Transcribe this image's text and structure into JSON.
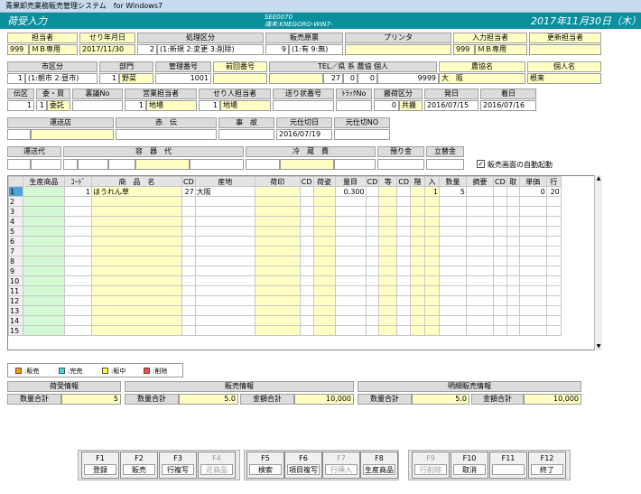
{
  "app_title": "青果卸売業務販売管理システム　for Windows7",
  "screen": {
    "title": "荷受入力",
    "program_id": "SEE0070",
    "terminal": "端末:KNEGORO-WIN7-",
    "date": "2017年11月30日（木）"
  },
  "row1": {
    "h_tanto": "担当者",
    "h_seri": "せり年月日",
    "h_shori": "処理区分",
    "h_hanbai": "販売原票",
    "h_printer": "プリンタ",
    "h_nyuryoku": "入力担当者",
    "h_koshin": "更新担当者",
    "tanto_code": "999",
    "tanto_name": "ＭＢ専用",
    "seri": "2017/11/30",
    "shori_code": "2",
    "shori_text": "(1:新規 2:変更 3:削除)",
    "hanbai_code": "9",
    "hanbai_text": "(1:有 9:無)",
    "nyuryoku_code": "999",
    "nyuryoku_name": "ＭＢ専用"
  },
  "row2": {
    "h_ichi": "市区分",
    "h_bumon": "部門",
    "h_kanri": "管理番号",
    "h_zenkai": "前回番号",
    "h_tel": "TEL／県 系 農協 個人",
    "h_nokyo": "農協名",
    "h_kojin": "個人名",
    "ichi_code": "1",
    "ichi_text": "(1:朝市 2:昼市)",
    "bumon_code": "1",
    "bumon_name": "野菜",
    "kanri": "1001",
    "tel_a": "27",
    "tel_b": "0",
    "tel_c": "0",
    "tel_d": "9999",
    "nokyo_name": "大　阪",
    "kojin_name": "根来"
  },
  "row3": {
    "h_denku": "伝区",
    "h_itaku": "委・買",
    "h_ura": "裏議No",
    "h_eigyo": "営業担当者",
    "h_seri_tanto": "せり人担当者",
    "h_okuri": "送り状番号",
    "h_truck": "ﾄﾗｯｸNo",
    "h_hanyu": "搬荷区分",
    "h_hatsu": "発日",
    "h_chaku": "着日",
    "denku": "1",
    "itaku_code": "1",
    "itaku_name": "委託",
    "eigyo_code": "1",
    "eigyo_name": "地場",
    "seri_code": "1",
    "seri_name": "地場",
    "hanyu_code": "0",
    "hanyu_name": "共搬",
    "hatsu": "2016/07/15",
    "chaku": "2016/07/16"
  },
  "row4": {
    "h_unso": "運送店",
    "h_akaden": "赤　伝",
    "h_jiko": "事　故",
    "h_motoshi": "元仕切日",
    "h_motoshi_no": "元仕切NO",
    "motoshi": "2016/07/19"
  },
  "row5": {
    "h_unsodai": "運送代",
    "h_yoki": "容　器　代",
    "h_reizo": "冷　蔵　費",
    "h_azukari": "預り金",
    "h_tatekae": "立替金",
    "auto_label": "販売画面の自動起動",
    "auto_checked": true
  },
  "grid": {
    "headers": [
      "",
      "生産商品",
      "ｺｰﾄﾞ",
      "商　品　名",
      "CD",
      "産地",
      "荷印",
      "CD",
      "荷姿",
      "量目",
      "CD",
      "等",
      "CD",
      "階",
      "入",
      "数量",
      "摘要",
      "CD",
      "取",
      "単価",
      "行"
    ],
    "rows": [
      {
        "n": "1",
        "code": "1",
        "name": "ほうれん草",
        "cd": "27",
        "origin": "大阪",
        "weight": "0.300",
        "iri": "1",
        "qty": "5",
        "price": "0",
        "gyo": "20"
      },
      {
        "n": "2"
      },
      {
        "n": "3"
      },
      {
        "n": "4"
      },
      {
        "n": "5"
      },
      {
        "n": "6"
      },
      {
        "n": "7"
      },
      {
        "n": "8"
      },
      {
        "n": "9"
      },
      {
        "n": "10"
      },
      {
        "n": "11"
      },
      {
        "n": "12"
      },
      {
        "n": "13"
      },
      {
        "n": "14"
      },
      {
        "n": "15"
      }
    ]
  },
  "legend": [
    {
      "label": ":販売",
      "color": "#ff9900"
    },
    {
      "label": ":完売",
      "color": "#33e0e0"
    },
    {
      "label": ":販中",
      "color": "#ffff33"
    },
    {
      "label": ":削除",
      "color": "#ff4444"
    }
  ],
  "summary": {
    "h_niuke": "荷受情報",
    "h_hanbai": "販売情報",
    "h_meisai": "明細販売情報",
    "l_qty": "数量合計",
    "l_amt": "金額合計",
    "niuke_qty": "5",
    "hanbai_qty": "5.0",
    "hanbai_amt": "10,000",
    "meisai_qty": "5.0",
    "meisai_amt": "10,000"
  },
  "fkeys": [
    {
      "k": "F1",
      "l": "登録"
    },
    {
      "k": "F2",
      "l": "販売"
    },
    {
      "k": "F3",
      "l": "行複写"
    },
    {
      "k": "F4",
      "l": "近商品"
    },
    {
      "k": "F5",
      "l": "検索"
    },
    {
      "k": "F6",
      "l": "項目複写"
    },
    {
      "k": "F7",
      "l": "行挿入"
    },
    {
      "k": "F8",
      "l": "生産商品"
    },
    {
      "k": "F9",
      "l": "行削除"
    },
    {
      "k": "F10",
      "l": "取消"
    },
    {
      "k": "F11",
      "l": ""
    },
    {
      "k": "F12",
      "l": "終了"
    }
  ]
}
